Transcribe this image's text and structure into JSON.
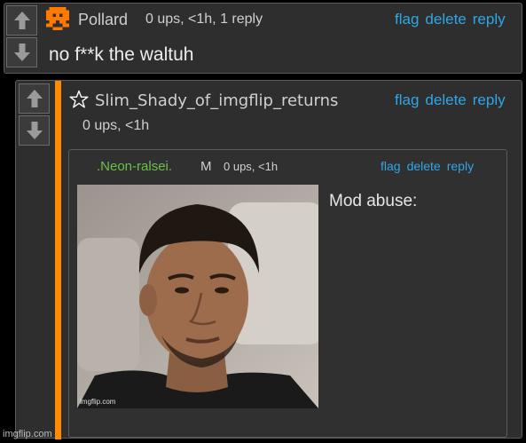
{
  "comment1": {
    "username": "Pollard",
    "meta": "0 ups, <1h, 1 reply",
    "text": "no f**k the waltuh",
    "actions": [
      "flag",
      "delete",
      "reply"
    ]
  },
  "comment2": {
    "username": "Slim_Shady_of_imgflip_returns",
    "meta": "0 ups, <1h",
    "actions": [
      "flag",
      "delete",
      "reply"
    ]
  },
  "comment3": {
    "username": ".Neon-ralsei.",
    "mod_badge": "M",
    "meta": "0 ups, <1h",
    "text": "Mod abuse:",
    "actions": [
      "flag",
      "delete",
      "reply"
    ],
    "photo_watermark": "imgflip.com"
  },
  "footer": {
    "watermark": "imgflip.com"
  },
  "colors": {
    "accent_orange": "#ff8c00",
    "link_blue": "#2fa6e6",
    "neon_green": "#6cc04a",
    "panel_bg": "#2e2e2e"
  }
}
